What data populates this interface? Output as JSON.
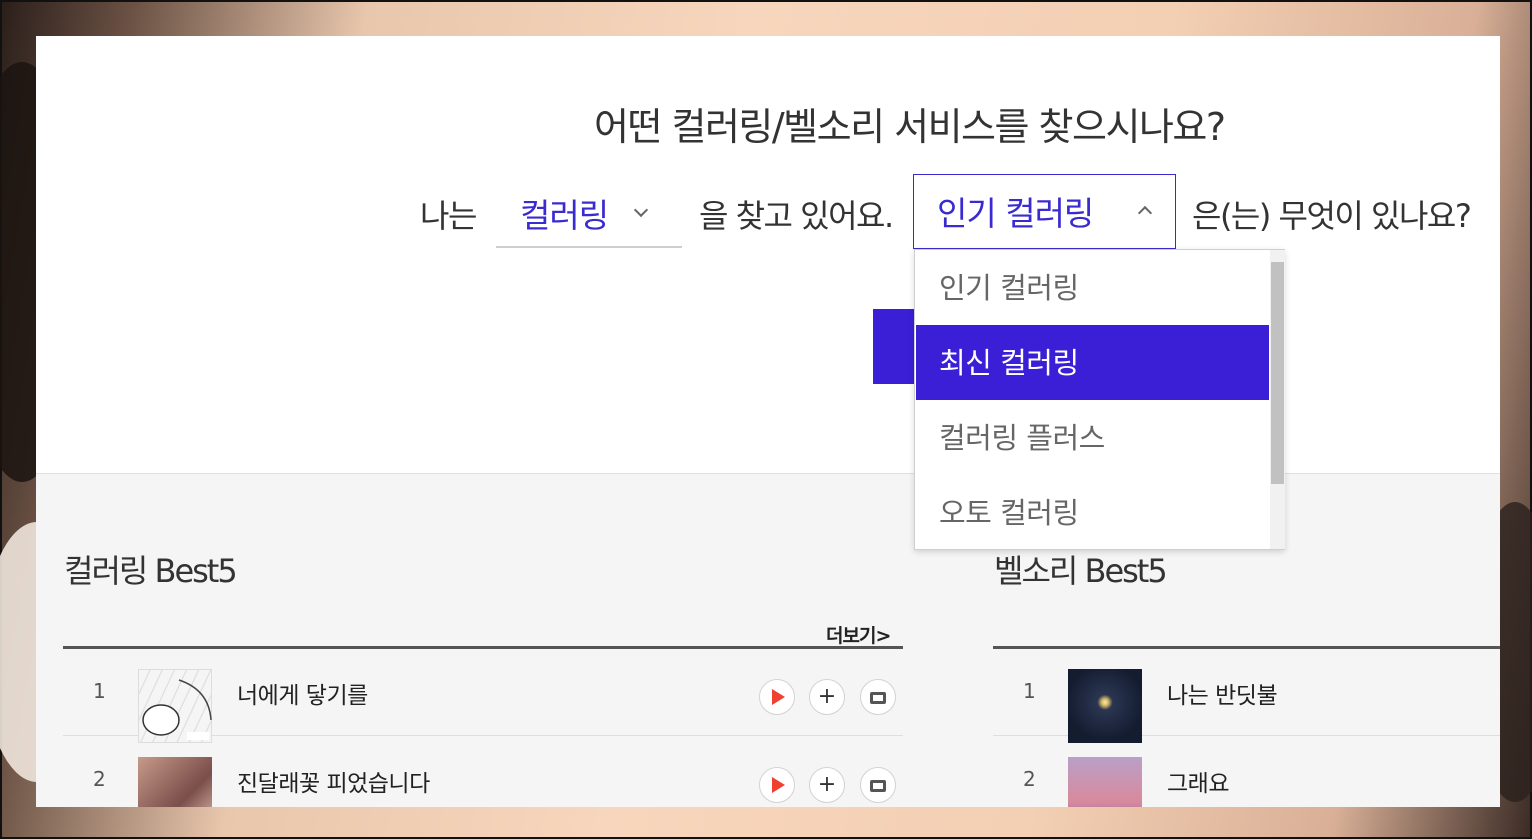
{
  "header": {
    "question": "어떤 컬러링/벨소리 서비스를 찾으시나요?"
  },
  "sentence": {
    "prefix": "나는",
    "service_select_value": "컬러링",
    "middle": "을 찾고 있어요.",
    "category_select_value": "인기 컬러링",
    "suffix": "은(는) 무엇이 있나요?"
  },
  "dropdown": {
    "options": [
      "인기 컬러링",
      "최신 컬러링",
      "컬러링 플러스",
      "오토 컬러링"
    ],
    "highlighted": "최신 컬러링"
  },
  "coloring_best": {
    "title": "컬러링 Best5",
    "more_label": "더보기>",
    "items": [
      {
        "rank": "1",
        "title": "너에게 닿기를"
      },
      {
        "rank": "2",
        "title": "진달래꽃 피었습니다"
      }
    ]
  },
  "bell_best": {
    "title": "벨소리 Best5",
    "items": [
      {
        "rank": "1",
        "title": "나는 반딧불"
      },
      {
        "rank": "2",
        "title": "그래요"
      }
    ]
  },
  "colors": {
    "accent": "#3a1fd6",
    "play": "#f0402f"
  }
}
